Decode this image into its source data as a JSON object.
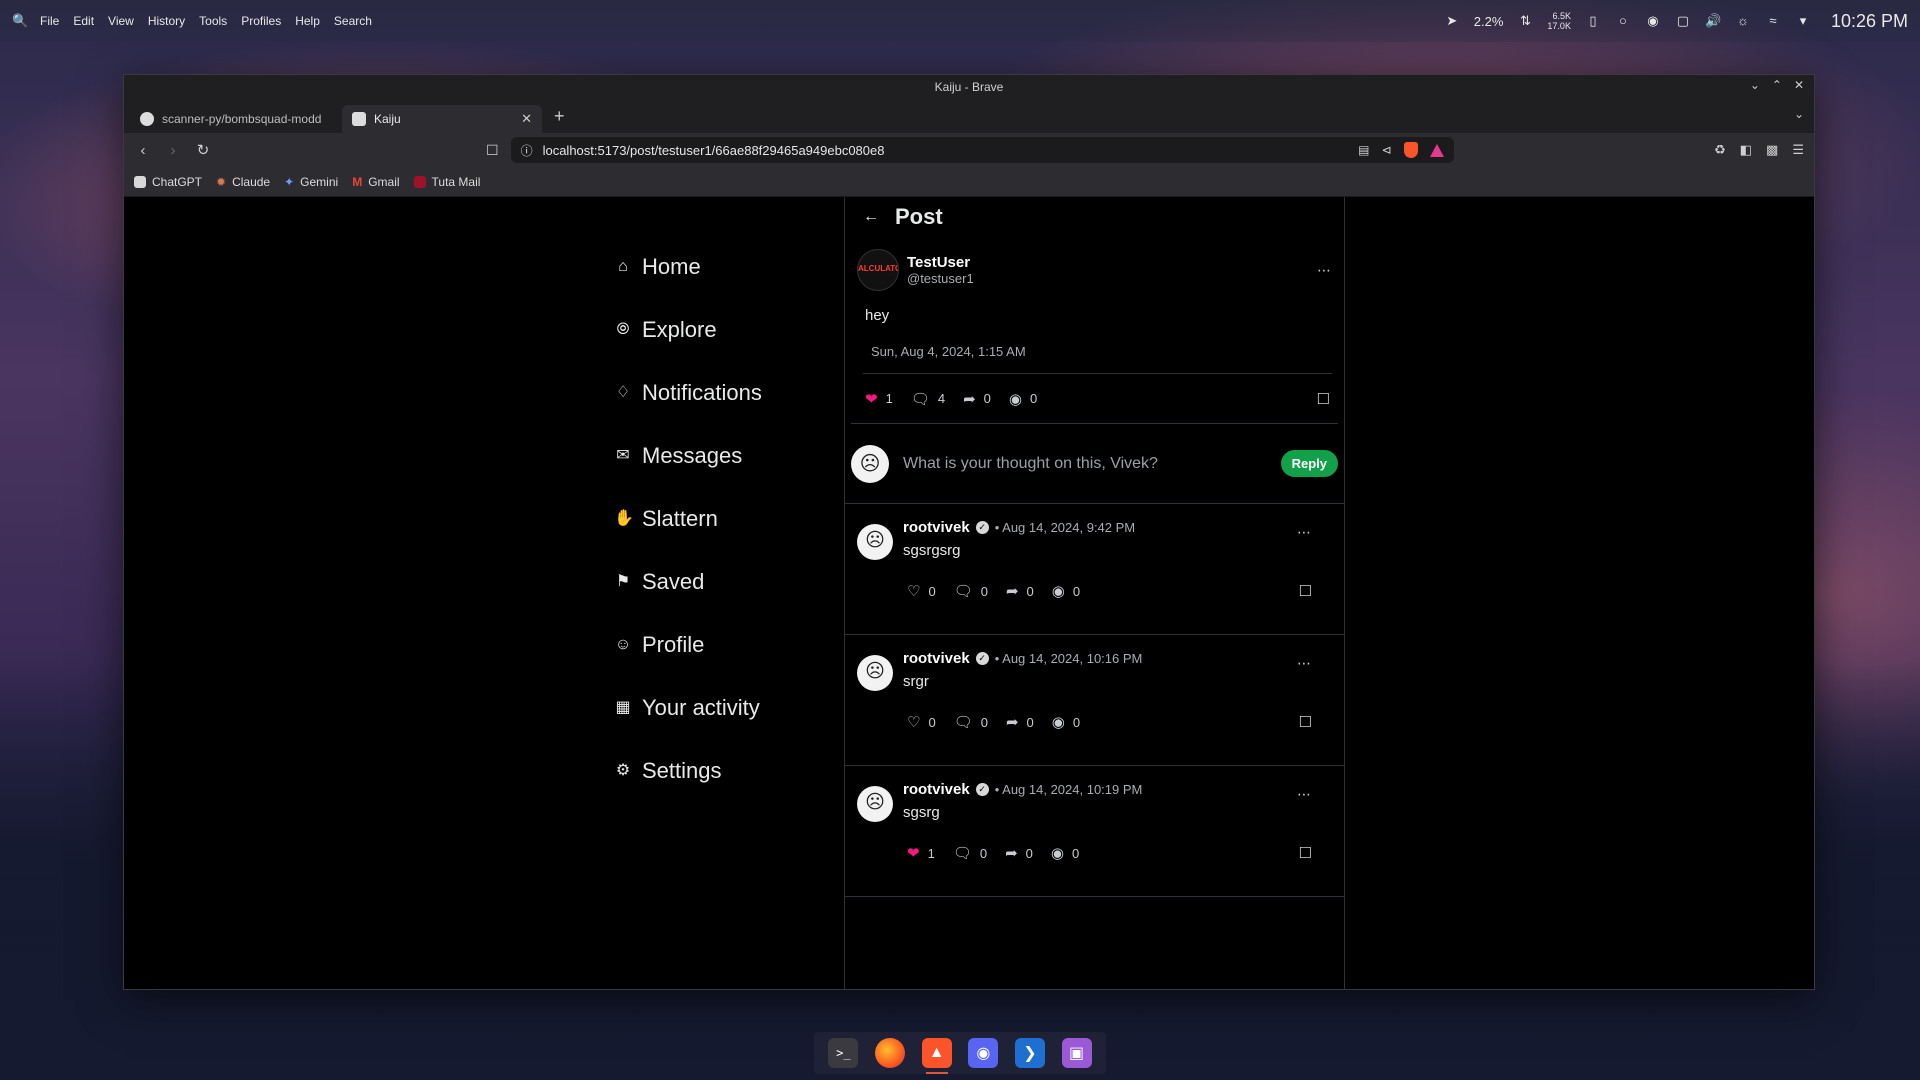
{
  "system_bar": {
    "menu": [
      "File",
      "Edit",
      "View",
      "History",
      "Tools",
      "Profiles",
      "Help",
      "Search"
    ],
    "cpu": "2.2%",
    "net_up": "6.5K",
    "net_down": "17.0K",
    "clock": "10:26 PM"
  },
  "window": {
    "title": "Kaiju - Brave",
    "tabs": [
      {
        "label": "scanner-py/bombsquad-modd",
        "active": false
      },
      {
        "label": "Kaiju",
        "active": true
      }
    ],
    "url": "localhost:5173/post/testuser1/66ae88f29465a949ebc080e8",
    "bookmarks": [
      "ChatGPT",
      "Claude",
      "Gemini",
      "Gmail",
      "Tuta Mail"
    ]
  },
  "sidebar": {
    "items": [
      {
        "label": "Home",
        "icon": "home-icon"
      },
      {
        "label": "Explore",
        "icon": "compass-icon"
      },
      {
        "label": "Notifications",
        "icon": "bell-icon"
      },
      {
        "label": "Messages",
        "icon": "mail-icon"
      },
      {
        "label": "Slattern",
        "icon": "hand-icon"
      },
      {
        "label": "Saved",
        "icon": "bookmark-icon"
      },
      {
        "label": "Profile",
        "icon": "user-icon"
      },
      {
        "label": "Your activity",
        "icon": "activity-icon"
      },
      {
        "label": "Settings",
        "icon": "gear-icon"
      }
    ]
  },
  "post": {
    "header": "Post",
    "author_name": "TestUser",
    "author_handle": "@testuser1",
    "avatar_text": "ALCULATOR",
    "text": "hey",
    "date": "Sun, Aug 4, 2024, 1:15 AM",
    "likes": "1",
    "comments": "4",
    "shares": "0",
    "views": "0"
  },
  "reply": {
    "placeholder": "What is your thought on this, Vivek?",
    "button": "Reply"
  },
  "comments": [
    {
      "name": "rootvivek",
      "meta": "• Aug 14, 2024, 9:42 PM",
      "text": "sgsrgsrg",
      "likes": "0",
      "comments": "0",
      "shares": "0",
      "views": "0",
      "liked": false
    },
    {
      "name": "rootvivek",
      "meta": "• Aug 14, 2024, 10:16 PM",
      "text": "srgr",
      "likes": "0",
      "comments": "0",
      "shares": "0",
      "views": "0",
      "liked": false
    },
    {
      "name": "rootvivek",
      "meta": "• Aug 14, 2024, 10:19 PM",
      "text": "sgsrg",
      "likes": "1",
      "comments": "0",
      "shares": "0",
      "views": "0",
      "liked": true
    }
  ],
  "colors": {
    "accent_green": "#13a04b",
    "like_pink": "#f91880",
    "brave_orange": "#fb542b"
  }
}
